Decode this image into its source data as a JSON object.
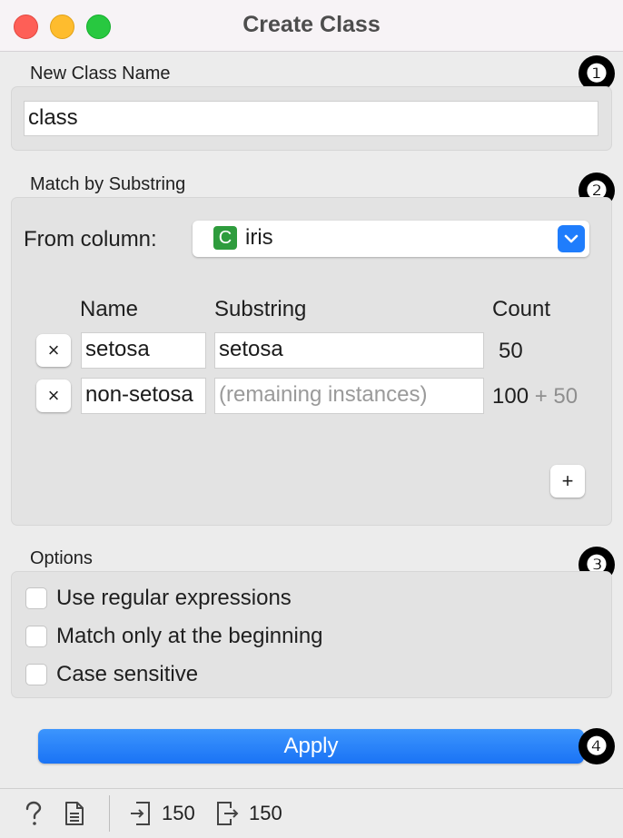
{
  "window": {
    "title": "Create Class"
  },
  "new_class": {
    "label": "New Class Name",
    "value": "class",
    "marker": "❶"
  },
  "match": {
    "label": "Match by Substring",
    "marker": "❷",
    "from_column_label": "From column:",
    "column": {
      "type_badge": "C",
      "name": "iris"
    },
    "headers": {
      "name": "Name",
      "substring": "Substring",
      "count": "Count"
    },
    "rows": [
      {
        "name": "setosa",
        "substring": "setosa",
        "substring_placeholder": "",
        "count": "50",
        "count_extra": ""
      },
      {
        "name": "non-setosa",
        "substring": "",
        "substring_placeholder": "(remaining instances)",
        "count": "100",
        "count_extra": "+ 50"
      }
    ],
    "add_label": "+",
    "remove_label": "×"
  },
  "options": {
    "label": "Options",
    "marker": "❸",
    "items": [
      {
        "label": "Use regular expressions",
        "checked": false
      },
      {
        "label": "Match only at the beginning",
        "checked": false
      },
      {
        "label": "Case sensitive",
        "checked": false
      }
    ]
  },
  "apply": {
    "label": "Apply",
    "marker": "❹"
  },
  "status": {
    "input_count": "150",
    "output_count": "150"
  },
  "colors": {
    "accent": "#1f7dfc",
    "badge_green": "#2e9c3d"
  },
  "icons": [
    "help-icon",
    "report-icon",
    "input-data-icon",
    "output-data-icon",
    "chevron-down-icon"
  ]
}
